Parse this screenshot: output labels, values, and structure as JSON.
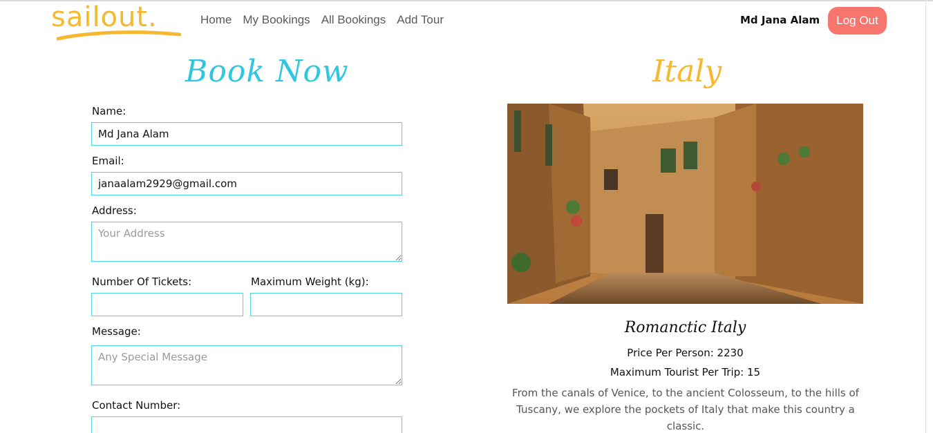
{
  "header": {
    "logo_text": "sailout.",
    "nav": [
      "Home",
      "My Bookings",
      "All Bookings",
      "Add Tour"
    ],
    "user_name": "Md Jana Alam",
    "logout_label": "Log Out"
  },
  "colors": {
    "brand_yellow": "#f5b82e",
    "accent_cyan": "#2fc6df",
    "logout_bg": "#f6766d",
    "field_border": "#4fd6e3"
  },
  "form": {
    "title": "Book Now",
    "name_label": "Name:",
    "name_value": "Md Jana Alam",
    "email_label": "Email:",
    "email_value": "janaalam2929@gmail.com",
    "address_label": "Address:",
    "address_placeholder": "Your Address",
    "tickets_label": "Number Of Tickets:",
    "weight_label": "Maximum Weight (kg):",
    "message_label": "Message:",
    "message_placeholder": "Any Special Message",
    "contact_label": "Contact Number:"
  },
  "tour": {
    "destination": "Italy",
    "name": "Romanctic Italy",
    "price_text": "Price Per Person: 2230",
    "max_text": "Maximum Tourist Per Trip: 15",
    "description": "From the canals of Venice, to the ancient Colosseum, to the hills of Tuscany, we explore the pockets of Italy that make this country a classic."
  }
}
